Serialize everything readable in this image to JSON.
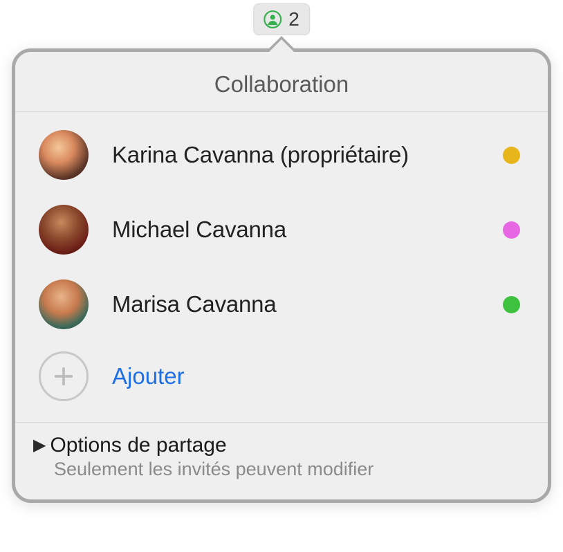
{
  "badge": {
    "count": "2",
    "icon": "person-icon",
    "iconColor": "#34B14C"
  },
  "popover": {
    "title": "Collaboration",
    "people": [
      {
        "name": "Karina Cavanna (propriétaire)",
        "dotColor": "#E7B61B"
      },
      {
        "name": "Michael Cavanna",
        "dotColor": "#E766E3"
      },
      {
        "name": "Marisa Cavanna",
        "dotColor": "#3FC23F"
      }
    ],
    "addLabel": "Ajouter",
    "options": {
      "title": "Options de partage",
      "subtitle": "Seulement les invités peuvent modifier"
    }
  }
}
